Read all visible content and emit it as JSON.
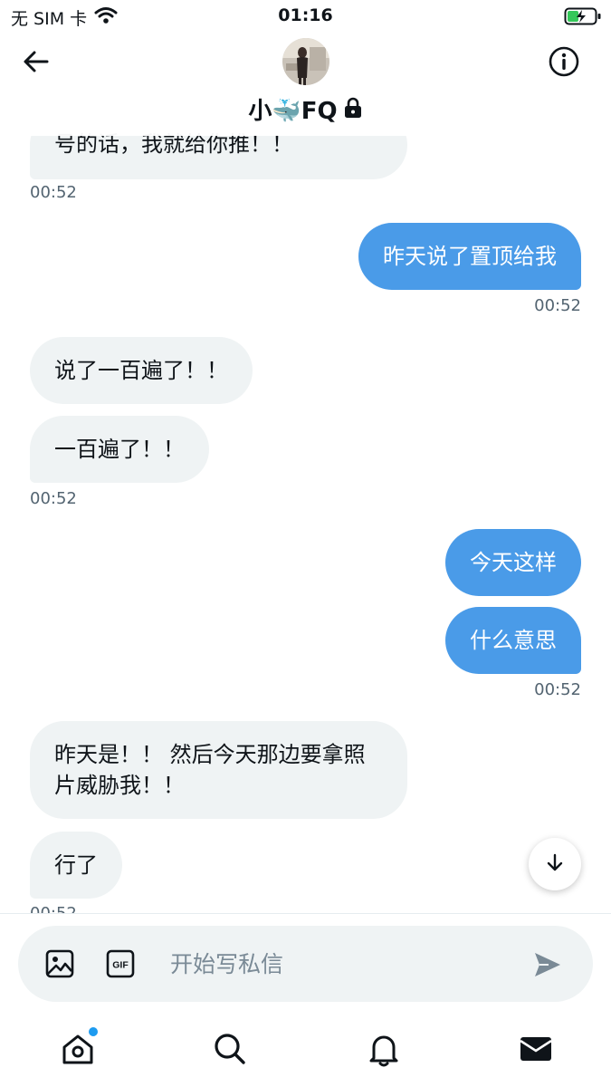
{
  "status_bar": {
    "carrier": "无 SIM 卡",
    "time": "01:16",
    "icons": [
      "wifi-icon",
      "battery-charging-icon"
    ]
  },
  "header": {
    "title": "小🐳FQ",
    "icons": [
      "back-arrow-icon",
      "lock-icon",
      "info-icon"
    ]
  },
  "messages": [
    {
      "direction": "in",
      "text": "号的话，我就给你推！！"
    },
    {
      "direction": "time",
      "text": "00:52"
    },
    {
      "direction": "out",
      "text": "昨天说了置顶给我"
    },
    {
      "direction": "time",
      "text": "00:52"
    },
    {
      "direction": "in",
      "text": "说了一百遍了！！"
    },
    {
      "direction": "in",
      "text": "一百遍了！！"
    },
    {
      "direction": "time",
      "text": "00:52"
    },
    {
      "direction": "out",
      "text": "今天这样"
    },
    {
      "direction": "out",
      "text": "什么意思"
    },
    {
      "direction": "time",
      "text": "00:52"
    },
    {
      "direction": "in",
      "text": "昨天是！！ 然后今天那边要拿照\n片威胁我！！"
    },
    {
      "direction": "in",
      "text": "行了"
    },
    {
      "direction": "time",
      "text": "00:52"
    }
  ],
  "composer": {
    "placeholder": "开始写私信",
    "icons": [
      "image-icon",
      "gif-icon",
      "send-icon"
    ]
  },
  "bottom_nav": {
    "items": [
      "home",
      "search",
      "notifications",
      "messages"
    ],
    "active": "messages",
    "home_has_badge": true
  },
  "colors": {
    "outgoing_bubble": "#4a9be8",
    "incoming_bubble": "#eff3f4",
    "accent": "#1d9bf0",
    "timestamp": "#536471"
  }
}
